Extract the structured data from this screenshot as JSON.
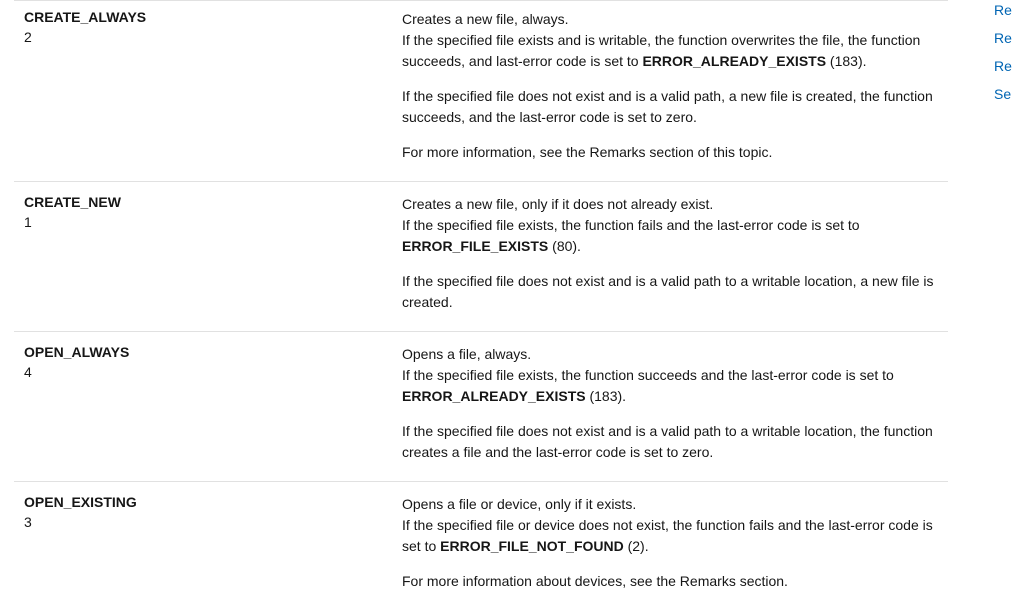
{
  "rows": [
    {
      "name": "CREATE_ALWAYS",
      "value": "2",
      "paragraphs": [
        {
          "lines": [
            {
              "text": "Creates a new file, always."
            },
            {
              "text": "If the specified file exists and is writable, the function overwrites the file, the function succeeds, and last-error code is set to ",
              "boldSuffix": "ERROR_ALREADY_EXISTS",
              "tail": " (183)."
            }
          ]
        },
        {
          "lines": [
            {
              "text": "If the specified file does not exist and is a valid path, a new file is created, the function succeeds, and the last-error code is set to zero."
            }
          ]
        },
        {
          "lines": [
            {
              "text": "For more information, see the Remarks section of this topic."
            }
          ]
        }
      ]
    },
    {
      "name": "CREATE_NEW",
      "value": "1",
      "paragraphs": [
        {
          "lines": [
            {
              "text": "Creates a new file, only if it does not already exist."
            },
            {
              "text": "If the specified file exists, the function fails and the last-error code is set to ",
              "boldSuffix": "ERROR_FILE_EXISTS",
              "tail": " (80)."
            }
          ]
        },
        {
          "lines": [
            {
              "text": "If the specified file does not exist and is a valid path to a writable location, a new file is created."
            }
          ]
        }
      ]
    },
    {
      "name": "OPEN_ALWAYS",
      "value": "4",
      "paragraphs": [
        {
          "lines": [
            {
              "text": "Opens a file, always."
            },
            {
              "text": "If the specified file exists, the function succeeds and the last-error code is set to ",
              "boldSuffix": "ERROR_ALREADY_EXISTS",
              "tail": " (183)."
            }
          ]
        },
        {
          "lines": [
            {
              "text": "If the specified file does not exist and is a valid path to a writable location, the function creates a file and the last-error code is set to zero."
            }
          ]
        }
      ]
    },
    {
      "name": "OPEN_EXISTING",
      "value": "3",
      "paragraphs": [
        {
          "lines": [
            {
              "text": "Opens a file or device, only if it exists."
            },
            {
              "text": "If the specified file or device does not exist, the function fails and the last-error code is set to ",
              "boldSuffix": "ERROR_FILE_NOT_FOUND",
              "tail": " (2)."
            }
          ]
        },
        {
          "lines": [
            {
              "text": "For more information about devices, see the Remarks section."
            }
          ]
        }
      ]
    }
  ],
  "sidebar": [
    "Re",
    "Re",
    "Re",
    "Se"
  ]
}
